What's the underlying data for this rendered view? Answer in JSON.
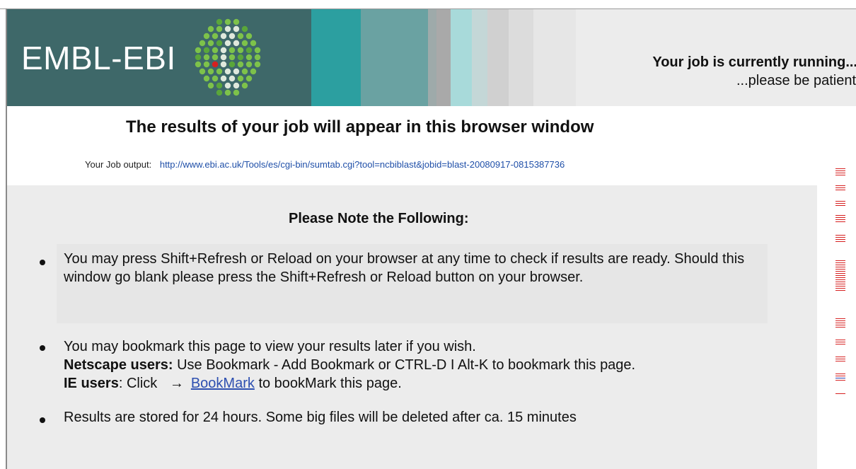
{
  "header": {
    "logo_text": "EMBL-EBI",
    "status_main": "Your job is currently running...",
    "status_sub": "...please be patient"
  },
  "results_title": "The results of your job will appear in this browser window",
  "job_output": {
    "label": "Your Job output:",
    "url": "http://www.ebi.ac.uk/Tools/es/cgi-bin/sumtab.cgi?tool=ncbiblast&jobid=blast-20080917-0815387736"
  },
  "notes": {
    "heading": "Please Note the Following:",
    "item1": "You may press Shift+Refresh or Reload on your browser at any time to check if results are ready. Should this window go blank please press the Shift+Refresh or Reload button on your browser.",
    "item2_intro": "You may bookmark this page to view your results later if you wish.",
    "netscape_label": "Netscape users:",
    "netscape_text": "Use Bookmark - Add Bookmark or CTRL-D I Alt-K to bookmark this page.",
    "ie_label": "IE users",
    "ie_click": ": Click",
    "arrow": "→",
    "bookmark_link": "BookMark",
    "ie_after": "to bookMark this  page.",
    "item3": "Results are stored for 24 hours. Some big files will be deleted after ca. 15 minutes"
  },
  "colors": {
    "logo_bg": "#3e6869",
    "accent_red": "#d62020",
    "link": "#1f4fa8"
  }
}
